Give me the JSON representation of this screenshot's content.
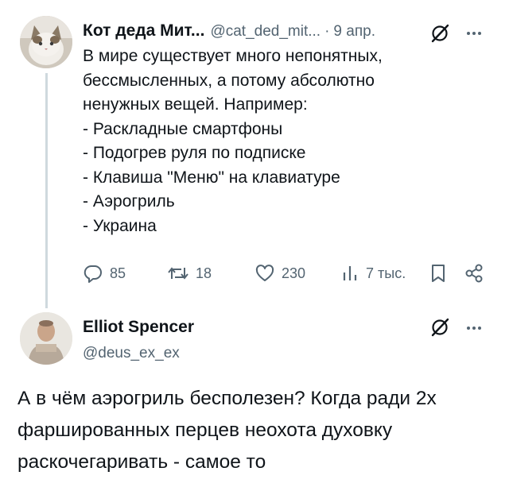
{
  "tweet1": {
    "author_name": "Кот деда Мит...",
    "handle": "@cat_ded_mit...",
    "separator": "·",
    "date": "9 апр.",
    "lines": [
      "В мире существует много непонятных,",
      "бессмысленных, а потому абсолютно",
      "ненужных вещей. Например:",
      "- Раскладные смартфоны",
      "- Подогрев руля по подписке",
      "- Клавиша \"Меню\" на клавиатуре",
      "- Аэрогриль",
      "- Украина"
    ],
    "actions": {
      "replies": "85",
      "reposts": "18",
      "likes": "230",
      "views": "7 тыс."
    }
  },
  "tweet2": {
    "author_name": "Elliot Spencer",
    "handle": "@deus_ex_ex",
    "lines": [
      "А в чём аэрогриль бесполезен? Когда ради 2х",
      "фаршированных перцев неохота духовку",
      "раскочегаривать - самое то"
    ]
  },
  "colors": {
    "text": "#0f1419",
    "secondary": "#536471",
    "thread_line": "#cfd9de"
  },
  "icons": [
    "grok-icon",
    "more-icon",
    "reply-icon",
    "repost-icon",
    "like-icon",
    "views-icon",
    "bookmark-icon",
    "share-icon"
  ]
}
